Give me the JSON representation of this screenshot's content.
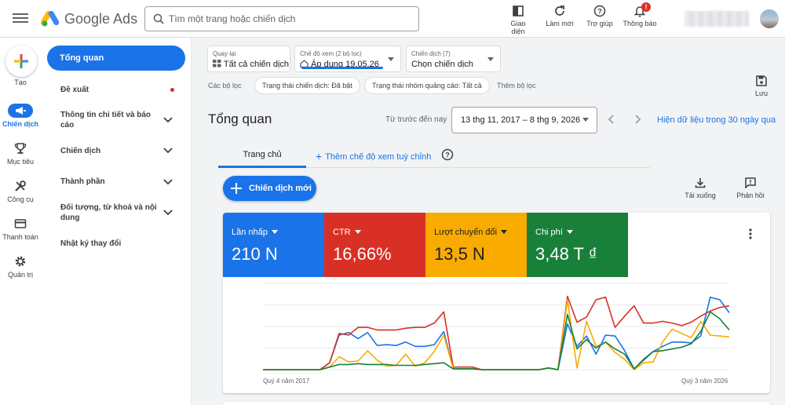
{
  "app": {
    "brand": "Google Ads"
  },
  "search": {
    "placeholder": "Tìm một trang hoặc chiến dịch"
  },
  "toolbar": {
    "appearance": "Giao diện",
    "refresh": "Làm mới",
    "help": "Trợ giúp",
    "notifications": "Thông báo",
    "notification_count": "!"
  },
  "rail": {
    "create": "Tạo",
    "campaigns": "Chiến dịch",
    "goals": "Mục tiêu",
    "tools": "Công cụ",
    "billing": "Thanh toán",
    "admin": "Quản trị"
  },
  "nav": {
    "overview": "Tổng quan",
    "recommendations": "Đề xuất",
    "insights": "Thông tin chi tiết và báo cáo",
    "campaigns": "Chiến dịch",
    "assets": "Thành phần",
    "audiences": "Đối tượng, từ khoá và nội dung",
    "change_history": "Nhật ký thay đổi"
  },
  "filters": {
    "back_label": "Quay lại",
    "back_value": "Tất cả chiến dịch",
    "view_label": "Chế độ xem (2 bộ lọc)",
    "view_value": "Áp dụng 19.05.26",
    "campaign_label": "Chiến dịch (7)",
    "campaign_value": "Chọn chiến dịch",
    "filters_label": "Các bộ lọc",
    "chip1": "Trạng thái chiến dịch: Đã bật",
    "chip2": "Trạng thái nhóm quảng cáo: Tất cả",
    "add_filter": "Thêm bộ lọc",
    "save": "Lưu"
  },
  "overview": {
    "title": "Tổng quan",
    "date_label": "Từ trước đến nay",
    "date_range": "13 thg 11, 2017 – 8 thg 9, 2026",
    "live_link": "Hiện dữ liệu trong 30 ngày qua"
  },
  "tabs": {
    "home": "Trang chủ",
    "add_view": "Thêm chế độ xem tuỳ chỉnh"
  },
  "actions": {
    "new_campaign": "Chiến dịch mới",
    "download": "Tải xuống",
    "feedback": "Phản hồi"
  },
  "metrics": [
    {
      "name": "Lần nhấp",
      "value": "210 N",
      "color": "#1a73e8"
    },
    {
      "name": "CTR",
      "value": "16,66%",
      "color": "#d93025"
    },
    {
      "name": "Lượt chuyển đổi",
      "value": "13,5 N",
      "color": "#f9ab00"
    },
    {
      "name": "Chi phí",
      "value": "3,48 T ₫",
      "color": "#188038"
    }
  ],
  "chart_data": {
    "type": "line",
    "x_start_label": "Quý 4 năm 2017",
    "x_end_label": "Quý 3 năm 2026",
    "series": [
      {
        "name": "Lần nhấp",
        "color": "#1a73e8",
        "values": [
          0,
          0,
          0,
          0,
          0,
          0,
          0,
          8,
          40,
          43,
          36,
          43,
          28,
          29,
          28,
          32,
          27,
          27,
          29,
          44,
          1,
          1,
          1,
          0,
          0,
          0,
          0,
          0,
          0,
          0,
          2,
          0,
          53,
          27,
          39,
          18,
          40,
          39,
          22,
          1,
          11,
          21,
          27,
          32,
          32,
          31,
          39,
          84,
          81,
          66
        ]
      },
      {
        "name": "CTR",
        "color": "#d93025",
        "values": [
          0,
          0,
          0,
          0,
          0,
          0,
          0,
          8,
          42,
          40,
          49,
          49,
          46,
          46,
          46,
          48,
          49,
          49,
          54,
          67,
          3,
          3,
          3,
          0,
          0,
          0,
          0,
          0,
          0,
          0,
          2,
          0,
          85,
          55,
          61,
          81,
          84,
          49,
          62,
          74,
          54,
          54,
          56,
          54,
          51,
          55,
          62,
          68,
          72,
          74
        ]
      },
      {
        "name": "Lượt chuyển đổi",
        "color": "#f9ab00",
        "values": [
          0,
          0,
          0,
          0,
          0,
          0,
          0,
          3,
          15,
          9,
          10,
          22,
          11,
          4,
          5,
          18,
          4,
          8,
          21,
          40,
          1,
          1,
          1,
          0,
          0,
          0,
          0,
          0,
          0,
          0,
          2,
          0,
          81,
          2,
          56,
          27,
          32,
          20,
          12,
          0,
          8,
          9,
          32,
          47,
          42,
          37,
          56,
          40,
          39,
          38
        ]
      },
      {
        "name": "Chi phí",
        "color": "#188038",
        "values": [
          0,
          0,
          0,
          0,
          0,
          0,
          0,
          3,
          6,
          6,
          7,
          6,
          6,
          6,
          5,
          5,
          5,
          6,
          7,
          8,
          1,
          1,
          1,
          0,
          0,
          0,
          0,
          0,
          0,
          0,
          2,
          0,
          64,
          24,
          35,
          25,
          32,
          24,
          18,
          1,
          12,
          21,
          22,
          24,
          26,
          30,
          44,
          67,
          59,
          46
        ]
      }
    ],
    "ylim": [
      0,
      100
    ],
    "grid": true
  }
}
